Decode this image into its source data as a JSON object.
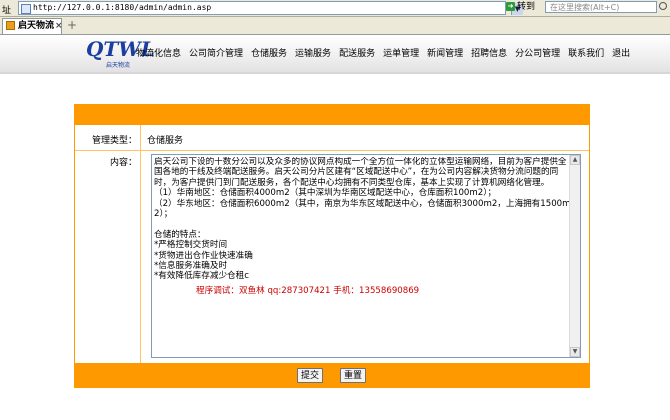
{
  "browser": {
    "address_label": "址",
    "url": "http://127.0.0.1:8180/admin/admin.asp",
    "go_label": "转到",
    "search_placeholder": "在这里搜索(Alt+C)",
    "tab_title": "启天物流",
    "tab_close": "×",
    "new_tab": "+"
  },
  "site": {
    "logo_text": "QTWL",
    "logo_sub": "启天物流",
    "nav": [
      "物流化信息",
      "公司简介管理",
      "仓储服务",
      "运输服务",
      "配送服务",
      "运单管理",
      "新闻管理",
      "招聘信息",
      "分公司管理",
      "联系我们",
      "退出"
    ]
  },
  "form": {
    "type_label": "管理类型：",
    "type_value": "仓储服务",
    "content_label": "内容：",
    "content_text": "启天公司下设的十数分公司以及众多的协议网点构成一个全方位一体化的立体型运输网络，目前为客户提供全国各地的干线及终端配送服务。启天公司分片区建有“区域配送中心”，在为公司内容解决货物分流问题的同时，为客户提供门到门配送服务，各个配送中心均拥有不同类型仓库，基本上实现了计算机网络化管理。\n（1）华南地区：仓储面积4000m2（其中深圳为华南区域配送中心，仓库面积100m2）；\n（2）华东地区：仓储面积6000m2（其中，南京为华东区域配送中心，仓储面积3000m2，上海拥有1500m2）；\n\n仓储的特点：\n*严格控制交货时间\n*货物进出仓作业快速准确\n*信息服务准确及时\n*有效降低库存减少仓租c\n",
    "credit_text": "程序调试：双鱼林 qq:287307421 手机：13558690869",
    "submit_label": "提交",
    "reset_label": "重置"
  },
  "colors": {
    "accent": "#ff9900",
    "logo": "#1b3ea0",
    "credit": "#cc0000"
  }
}
